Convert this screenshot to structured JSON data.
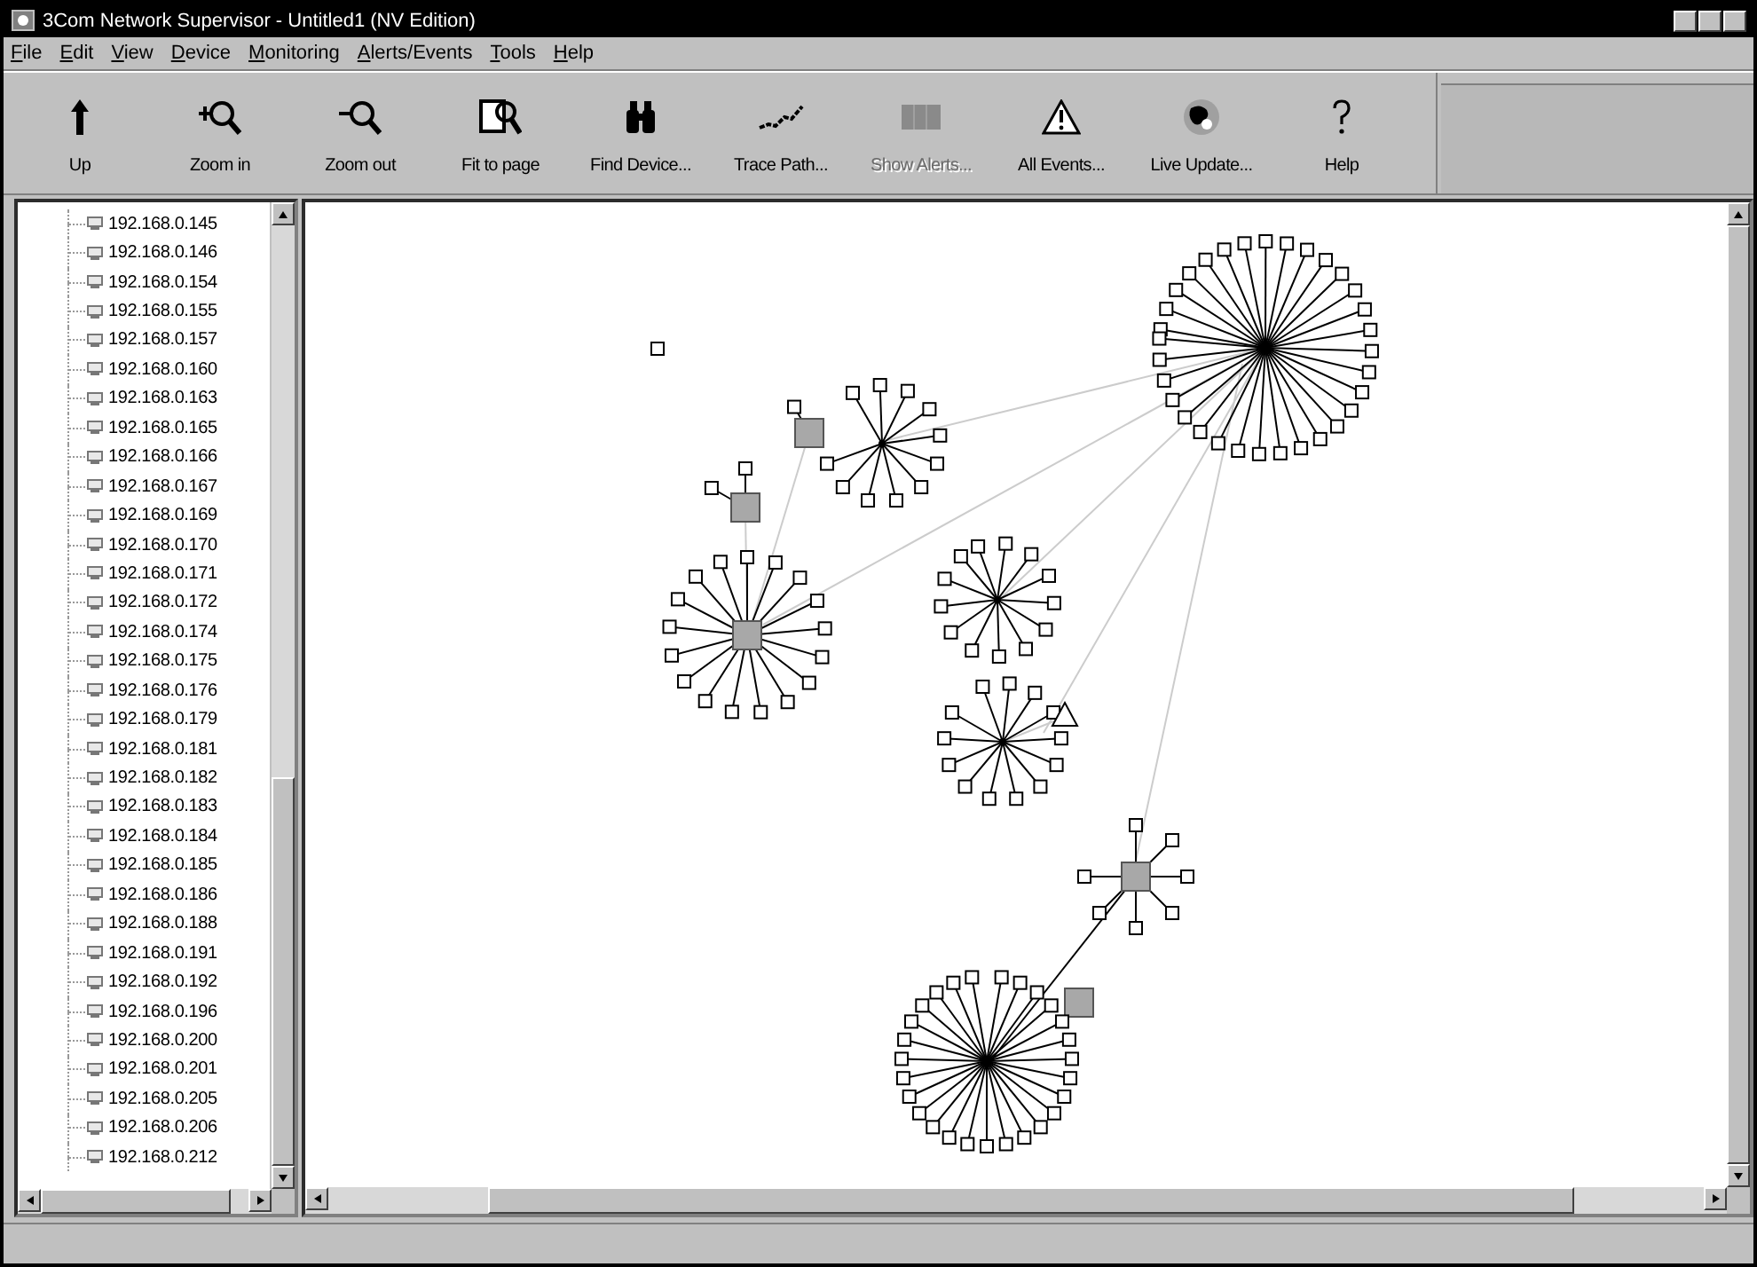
{
  "window": {
    "title": "3Com Network Supervisor - Untitled1 (NV Edition)"
  },
  "menu": [
    "File",
    "Edit",
    "View",
    "Device",
    "Monitoring",
    "Alerts/Events",
    "Tools",
    "Help"
  ],
  "toolbar": [
    {
      "label": "Up",
      "disabled": false
    },
    {
      "label": "Zoom in",
      "disabled": false
    },
    {
      "label": "Zoom out",
      "disabled": false
    },
    {
      "label": "Fit to page",
      "disabled": false
    },
    {
      "label": "Find Device...",
      "disabled": false
    },
    {
      "label": "Trace Path...",
      "disabled": false
    },
    {
      "label": "Show Alerts...",
      "disabled": true
    },
    {
      "label": "All Events...",
      "disabled": false
    },
    {
      "label": "Live Update...",
      "disabled": false
    },
    {
      "label": "Help",
      "disabled": false
    }
  ],
  "tree": {
    "items": [
      "192.168.0.145",
      "192.168.0.146",
      "192.168.0.154",
      "192.168.0.155",
      "192.168.0.157",
      "192.168.0.160",
      "192.168.0.163",
      "192.168.0.165",
      "192.168.0.166",
      "192.168.0.167",
      "192.168.0.169",
      "192.168.0.170",
      "192.168.0.171",
      "192.168.0.172",
      "192.168.0.174",
      "192.168.0.175",
      "192.168.0.176",
      "192.168.0.179",
      "192.168.0.181",
      "192.168.0.182",
      "192.168.0.183",
      "192.168.0.184",
      "192.168.0.185",
      "192.168.0.186",
      "192.168.0.188",
      "192.168.0.191",
      "192.168.0.192",
      "192.168.0.196",
      "192.168.0.200",
      "192.168.0.201",
      "192.168.0.205",
      "192.168.0.206",
      "192.168.0.212"
    ]
  }
}
